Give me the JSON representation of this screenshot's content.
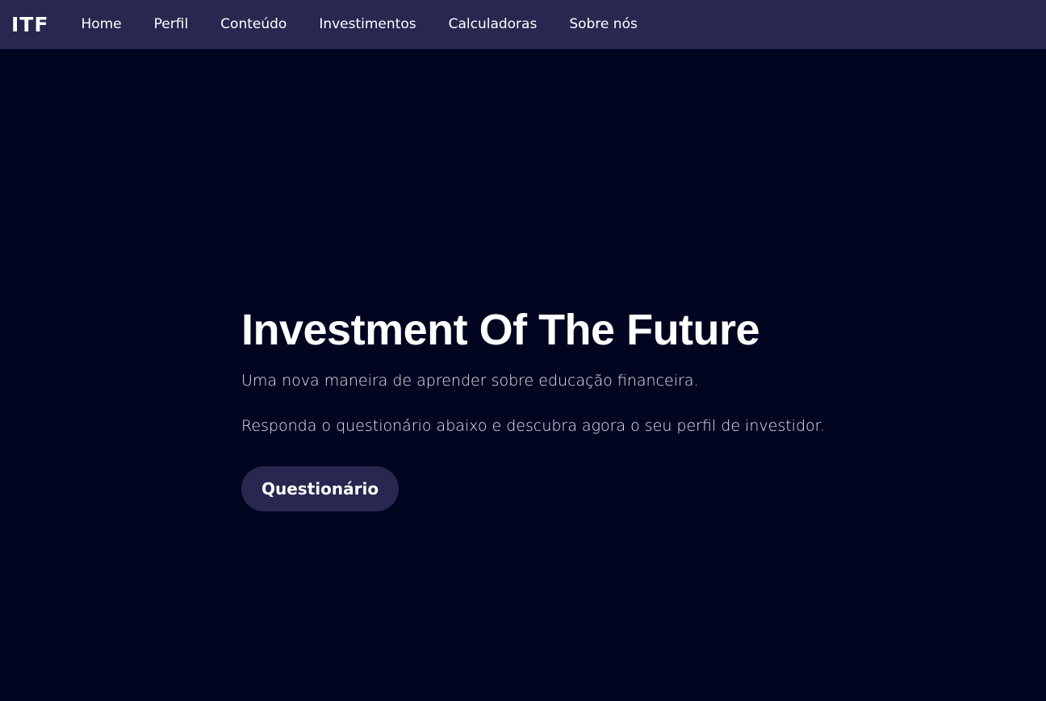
{
  "navbar": {
    "brand": "ITF",
    "links": [
      {
        "label": "Home"
      },
      {
        "label": "Perfil"
      },
      {
        "label": "Conteúdo"
      },
      {
        "label": "Investimentos"
      },
      {
        "label": "Calculadoras"
      },
      {
        "label": "Sobre nós"
      }
    ]
  },
  "hero": {
    "title": "Investment Of The Future",
    "subtitle": "Uma nova maneira de aprender sobre educação financeira.",
    "description": "Responda o questionário abaixo e descubra agora o seu perfil de investidor.",
    "button_label": "Questionário"
  },
  "colors": {
    "background": "#020520",
    "navbar": "#272750",
    "button": "#272750",
    "text": "#ffffff"
  }
}
